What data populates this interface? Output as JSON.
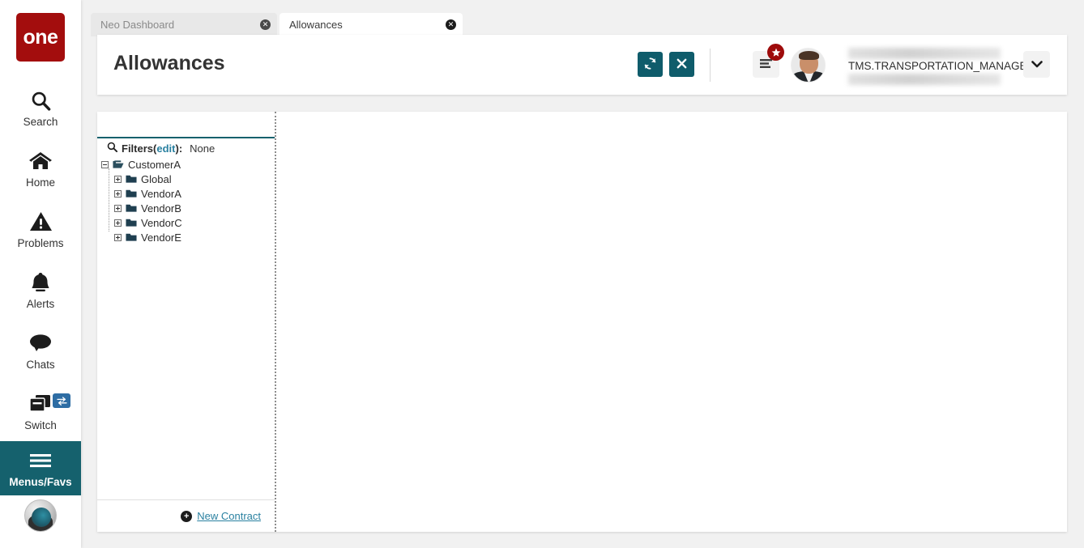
{
  "brand": {
    "logo_text": "one",
    "logo_color": "#a30d0d",
    "accent_teal": "#15616d",
    "accent_link": "#2980a0",
    "badge_red": "#9e0b0b"
  },
  "rail": {
    "items": [
      {
        "label": "Search",
        "icon": "search-icon"
      },
      {
        "label": "Home",
        "icon": "home-icon"
      },
      {
        "label": "Problems",
        "icon": "warning-triangle-icon"
      },
      {
        "label": "Alerts",
        "icon": "bell-icon"
      },
      {
        "label": "Chats",
        "icon": "chat-bubble-icon"
      },
      {
        "label": "Switch",
        "icon": "windows-stack-icon",
        "badge_icon": "swap-arrows-icon"
      },
      {
        "label": "Menus/Favs",
        "icon": "hamburger-icon",
        "active": true
      }
    ],
    "avatar_icon": "user-avatar-icon"
  },
  "tabs": [
    {
      "label": "Neo Dashboard",
      "active": false,
      "close_icon": "close-circle-icon"
    },
    {
      "label": "Allowances",
      "active": true,
      "close_icon": "close-circle-icon"
    }
  ],
  "header": {
    "title": "Allowances",
    "refresh_button": {
      "label": "↻",
      "name": "refresh-button",
      "icon": "refresh-icon"
    },
    "close_button": {
      "label": "✕",
      "name": "close-button",
      "icon": "x-icon"
    },
    "menu_list_button": {
      "icon": "list-lines-icon"
    },
    "star_badge": {
      "icon": "star-icon",
      "glyph": "★"
    },
    "user": {
      "role": "TMS.TRANSPORTATION_MANAGER",
      "name_redacted": true,
      "avatar_icon": "user-photo-avatar"
    },
    "user_dropdown": {
      "icon": "chevron-down-icon",
      "glyph": "⌄"
    }
  },
  "content": {
    "filters": {
      "search_icon": "search-icon",
      "label": "Filters",
      "open_paren": "(",
      "edit_link": "edit",
      "close_paren": "):",
      "value": "None"
    },
    "tree": {
      "root": {
        "label": "CustomerA",
        "expanded": true,
        "toggle": "minus-box-icon",
        "folder_icon": "folder-open-icon"
      },
      "children": [
        {
          "label": "Global",
          "expanded": false,
          "toggle": "plus-box-icon",
          "folder_icon": "folder-closed-icon"
        },
        {
          "label": "VendorA",
          "expanded": false,
          "toggle": "plus-box-icon",
          "folder_icon": "folder-closed-icon"
        },
        {
          "label": "VendorB",
          "expanded": false,
          "toggle": "plus-box-icon",
          "folder_icon": "folder-closed-icon"
        },
        {
          "label": "VendorC",
          "expanded": false,
          "toggle": "plus-box-icon",
          "folder_icon": "folder-closed-icon"
        },
        {
          "label": "VendorE",
          "expanded": false,
          "toggle": "plus-box-icon",
          "folder_icon": "folder-closed-icon"
        }
      ]
    },
    "footer": {
      "new_contract": {
        "label": "New Contract",
        "icon": "plus-circle-icon",
        "glyph": "+"
      }
    },
    "detail_pane_empty": true
  }
}
